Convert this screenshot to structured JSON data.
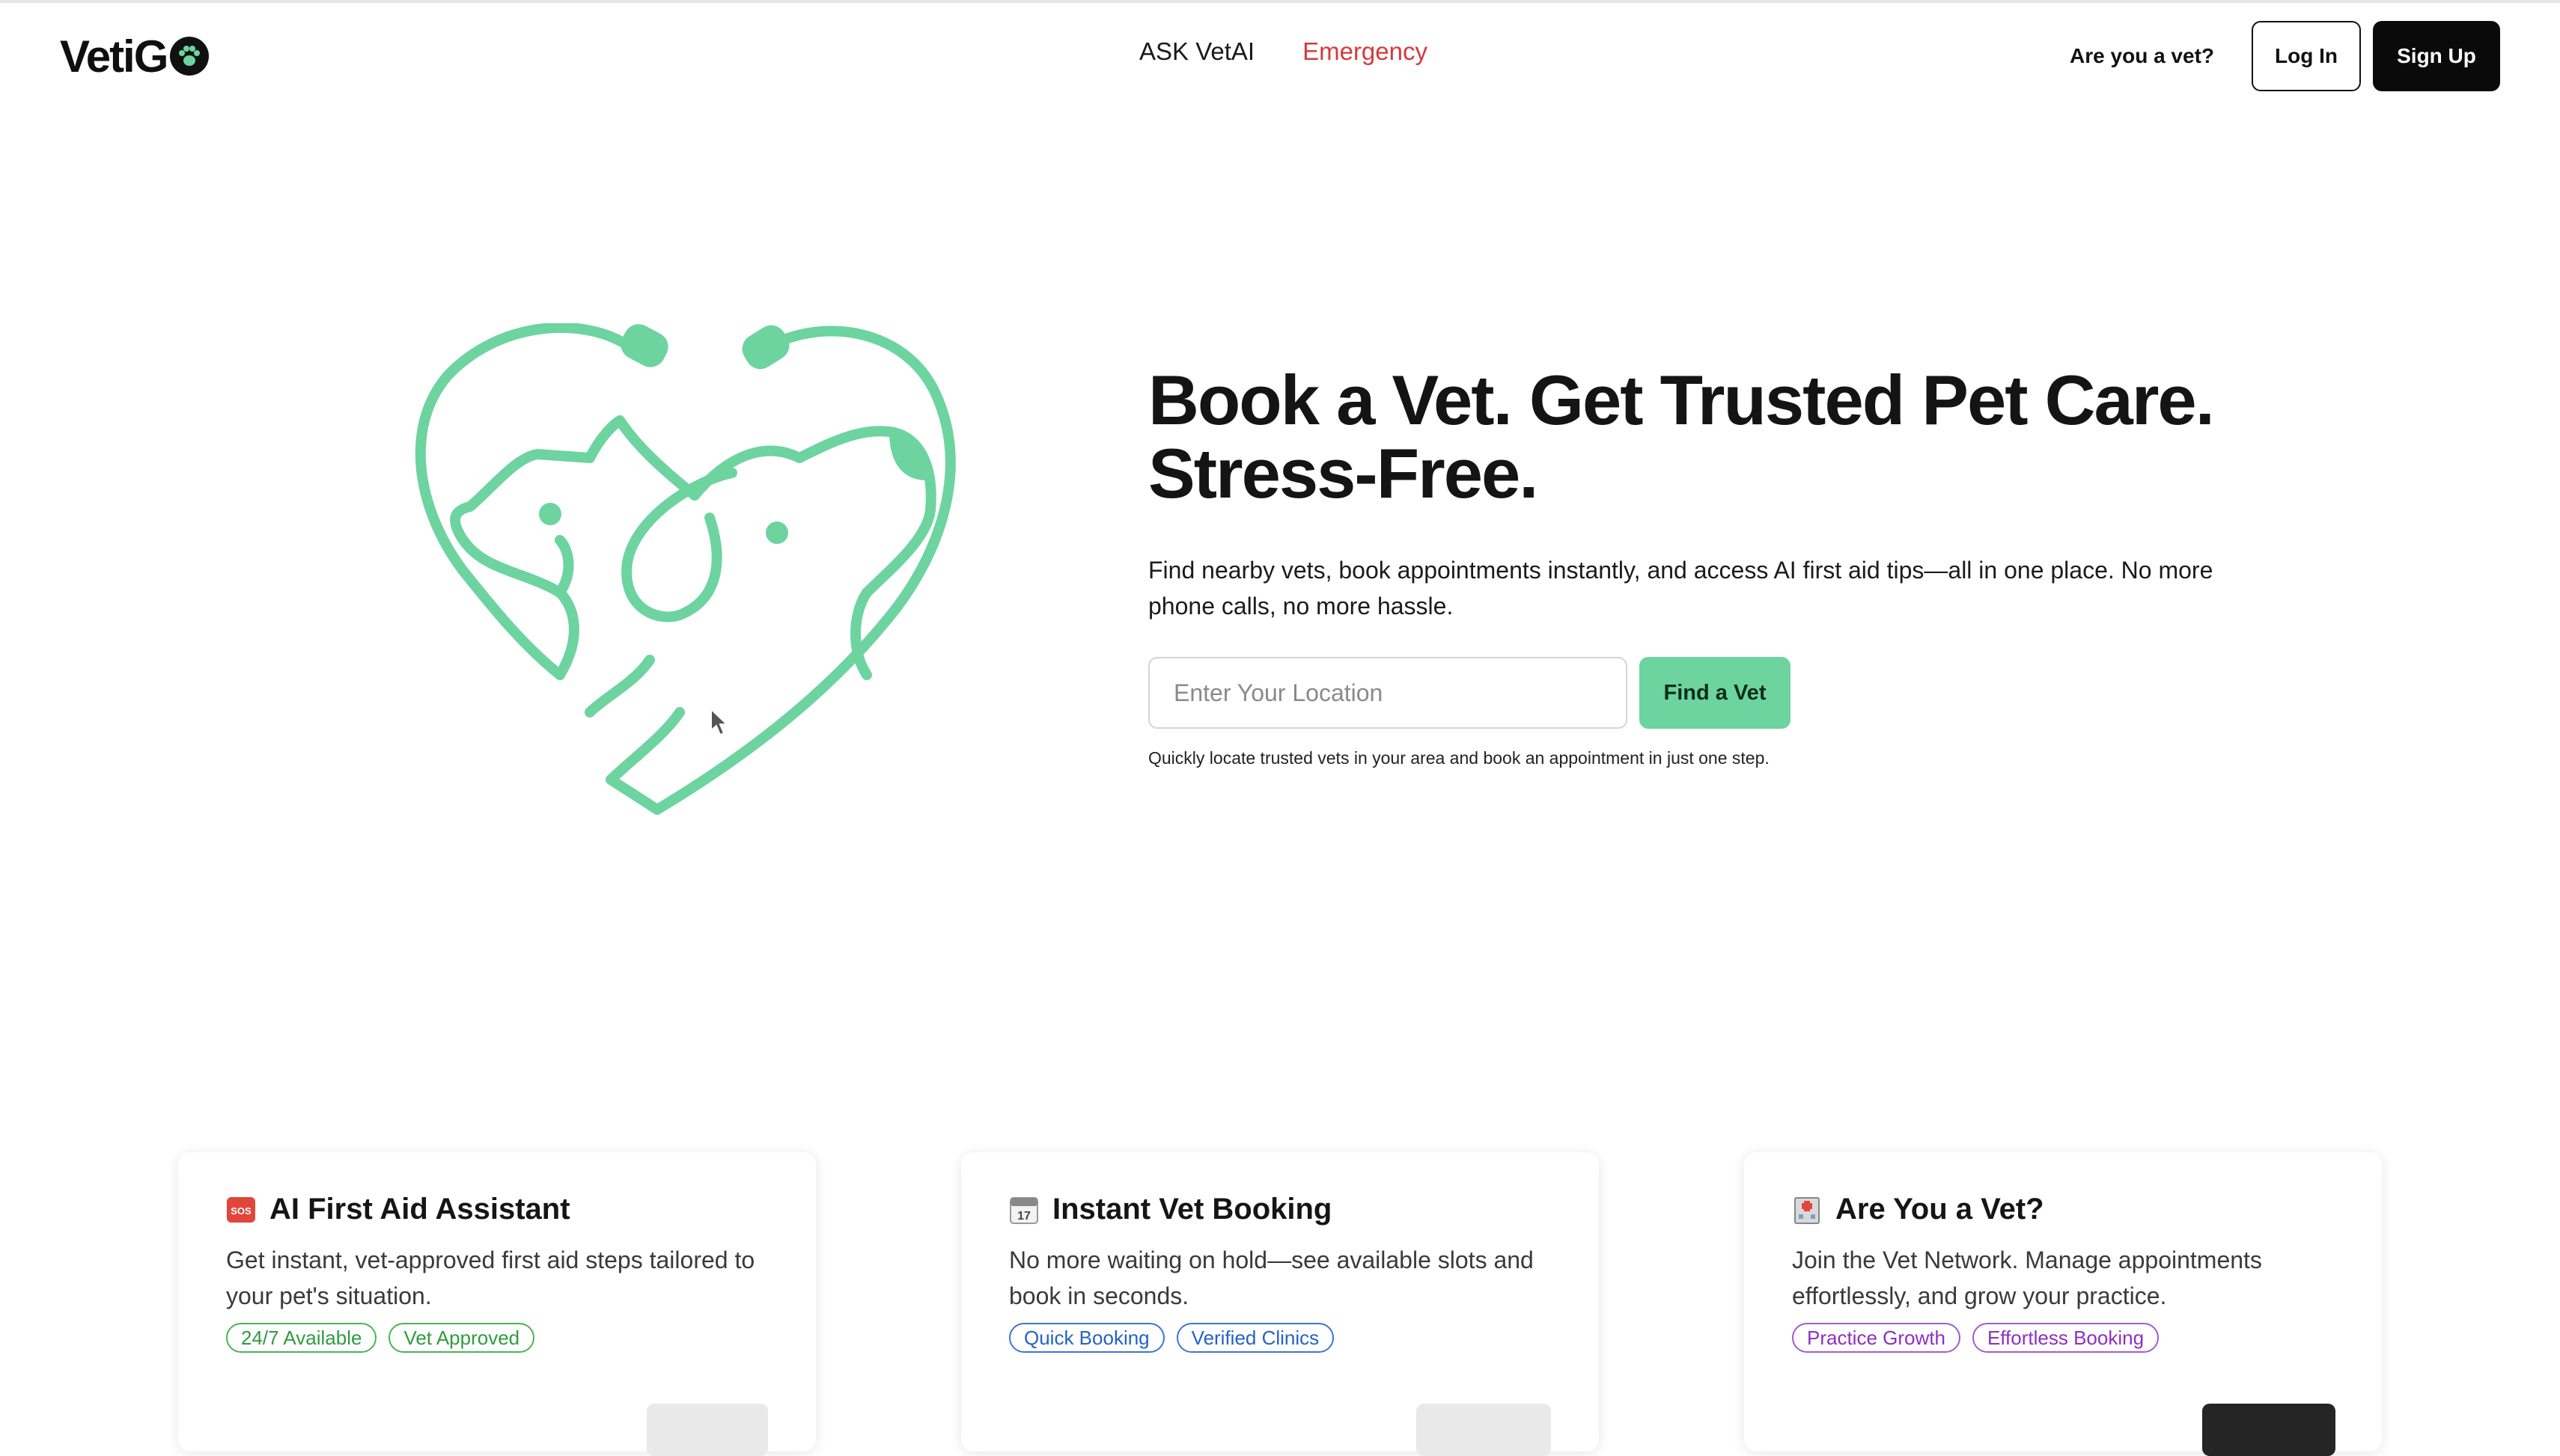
{
  "header": {
    "logo_text": "VetiG",
    "nav": [
      {
        "label": "ASK VetAI"
      },
      {
        "label": "Emergency"
      }
    ],
    "are_vet_label": "Are you a vet?",
    "login_label": "Log In",
    "signup_label": "Sign Up"
  },
  "hero": {
    "title_line1": "Book a Vet. Get Trusted Pet Care.",
    "title_line2": "Stress-Free.",
    "subtitle": "Find nearby vets, book appointments instantly, and access AI first aid tips—all in one place. No more phone calls, no more hassle.",
    "search_placeholder": "Enter Your Location",
    "search_value": "",
    "find_button": "Find a Vet",
    "note": "Quickly locate trusted vets in your area and book an appointment in just one step."
  },
  "cards": [
    {
      "icon": "sos-icon",
      "title": "AI First Aid Assistant",
      "description": "Get instant, vet-approved first aid steps tailored to your pet's situation.",
      "tags": [
        "24/7 Available",
        "Vet Approved"
      ]
    },
    {
      "icon": "calendar-icon",
      "title": "Instant Vet Booking",
      "description": "No more waiting on hold—see available slots and book in seconds.",
      "tags": [
        "Quick Booking",
        "Verified Clinics"
      ]
    },
    {
      "icon": "hospital-icon",
      "title": "Are You a Vet?",
      "description": "Join the Vet Network. Manage appointments effortlessly, and grow your practice.",
      "tags": [
        "Practice Growth",
        "Effortless Booking"
      ]
    }
  ],
  "colors": {
    "accent_green": "#6dd49f",
    "emergency_red": "#d8393b",
    "primary_dark": "#0a0a0a"
  }
}
